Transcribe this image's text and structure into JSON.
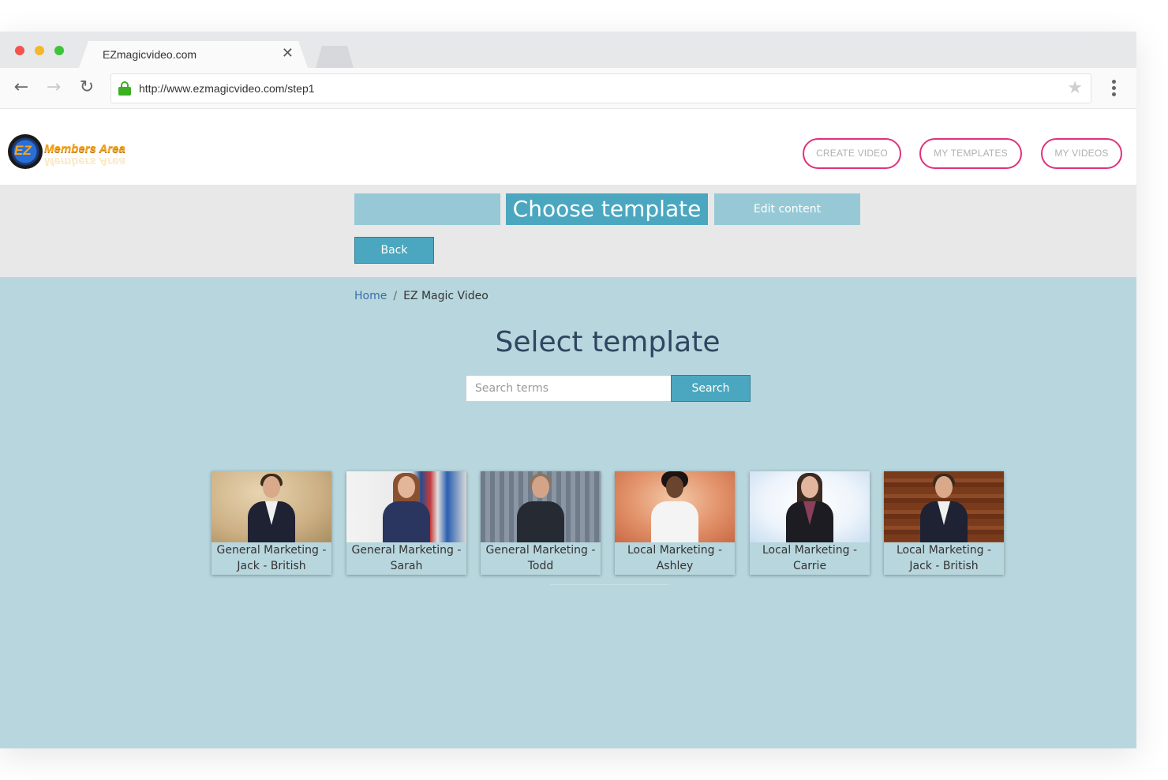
{
  "browser": {
    "tab_title": "EZmagicvideo.com",
    "tab_close_glyph": "✕",
    "url": "http://www.ezmagicvideo.com/step1",
    "back_glyph": "←",
    "forward_glyph": "→",
    "reload_glyph": "↻",
    "star_glyph": "★"
  },
  "header": {
    "logo_mark": "EZ",
    "logo_text": "Members Area",
    "nav": [
      {
        "label": "CREATE VIDEO"
      },
      {
        "label": "MY TEMPLATES"
      },
      {
        "label": "MY VIDEOS"
      }
    ]
  },
  "steps": {
    "active": "Choose template",
    "next": "Edit content",
    "back_label": "Back"
  },
  "breadcrumb": {
    "home": "Home",
    "separator": "/",
    "current": "EZ Magic Video"
  },
  "main": {
    "title": "Select template",
    "search_placeholder": "Search terms",
    "search_button": "Search"
  },
  "templates": [
    {
      "title": "General Marketing - Jack - British"
    },
    {
      "title": "General Marketing - Sarah"
    },
    {
      "title": "General Marketing - Todd"
    },
    {
      "title": "Local Marketing - Ashley"
    },
    {
      "title": "Local Marketing - Carrie"
    },
    {
      "title": "Local Marketing - Jack - British"
    }
  ],
  "colors": {
    "accent": "#4aa7bf",
    "step_inactive": "#96c9d5",
    "nav_pill_border": "#e0327c",
    "main_bg": "#b8d6dd",
    "band_bg": "#e8e8e8"
  }
}
